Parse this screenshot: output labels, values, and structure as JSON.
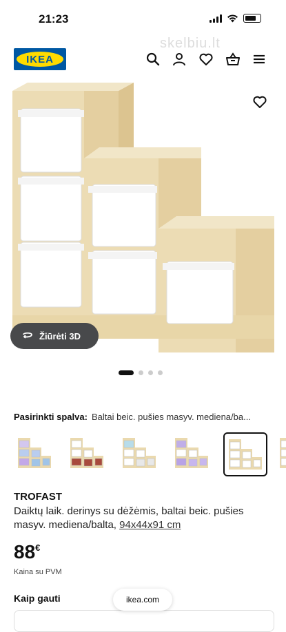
{
  "status_bar": {
    "time": "21:23"
  },
  "watermark": "skelbiu.lt",
  "header": {
    "logo_text": "IKEA",
    "icons": [
      "search-icon",
      "user-icon",
      "heart-icon",
      "basket-icon",
      "menu-icon"
    ]
  },
  "gallery": {
    "view_3d_label": "Žiūrėti 3D",
    "slide_count": 4,
    "active_slide": 1
  },
  "color_selector": {
    "label": "Pasirinkti spalva:",
    "value": "Baltai beic. pušies masyv. mediena/ba...",
    "options": [
      {
        "bins": [
          "#d3c7ef",
          "#b9cdef",
          "#c2a8e8",
          "#a0c4e8"
        ],
        "selected": false
      },
      {
        "bins": [
          "#ffffff",
          "#ffffff",
          "#a84a3c",
          "#a84a3c"
        ],
        "selected": false
      },
      {
        "bins": [
          "#b7dcea",
          "#ffffff",
          "#ffffff",
          "#e8e8e8"
        ],
        "selected": false
      },
      {
        "bins": [
          "#c0aee8",
          "#ffffff",
          "#b8a2e6",
          "#c7b6ee"
        ],
        "selected": false
      },
      {
        "bins": [
          "#ffffff",
          "#ffffff",
          "#ffffff",
          "#ffffff"
        ],
        "selected": true
      },
      {
        "bins": [
          "#ffffff",
          "#ffffff",
          "#ffffff",
          "#ffffff"
        ],
        "selected": false
      }
    ]
  },
  "product": {
    "name": "TROFAST",
    "description": "Daiktų laik. derinys su dėžėmis, baltai beic. pušies masyv. mediena/balta,",
    "dimensions": "94x44x91 cm",
    "price_main": "88",
    "price_currency": "€",
    "vat_note": "Kaina su PVM"
  },
  "delivery": {
    "title": "Kaip gauti"
  },
  "browser": {
    "url": "ikea.com"
  }
}
